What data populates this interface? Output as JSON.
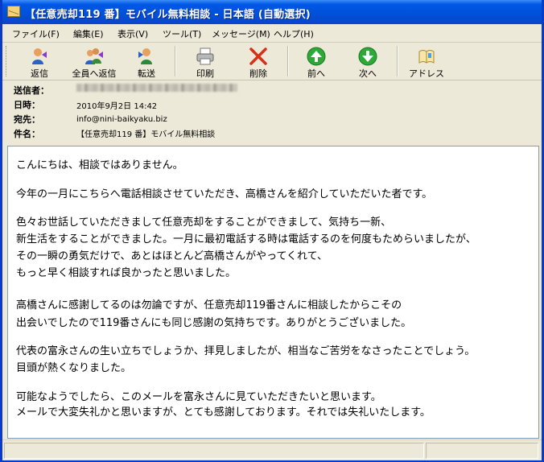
{
  "window": {
    "title": "【任意売却119 番】モバイル無料相談 - 日本語 (自動選択)"
  },
  "menu": [
    {
      "label": "ファイル(F)"
    },
    {
      "label": "編集(E)"
    },
    {
      "label": "表示(V)"
    },
    {
      "label": "ツール(T)"
    },
    {
      "label": "メッセージ(M)"
    },
    {
      "label": "ヘルプ(H)"
    }
  ],
  "toolbar": {
    "reply": "返信",
    "reply_all": "全員へ返信",
    "forward": "転送",
    "print": "印刷",
    "delete": "削除",
    "previous": "前へ",
    "next": "次へ",
    "addresses": "アドレス"
  },
  "header": {
    "from_label": "送信者：",
    "date_label": "日時：",
    "date_value": "2010年9月2日 14:42",
    "to_label": "宛先：",
    "to_value": "info@nini-baikyaku.biz",
    "subject_label": "件名：",
    "subject_value": "【任意売却119 番】モバイル無料相談"
  },
  "message": {
    "p1": "こんにちは、相談ではありません。",
    "p2": "今年の一月にこちらへ電話相談させていただき、高橋さんを紹介していただいた者です。",
    "p3_l1": "色々お世話していただきまして任意売却をすることができまして、気持ち一新、",
    "p3_l2": "新生活をすることができました。一月に最初電話する時は電話するのを何度もためらいましたが、",
    "p3_l3": "その一瞬の勇気だけで、あとはほとんど高橋さんがやってくれて、",
    "p3_l4": "もっと早く相談すれば良かったと思いました。",
    "p4_l1": "高橋さんに感謝してるのは勿論ですが、任意売却119番さんに相談したからこその",
    "p4_l2": "出会いでしたので119番さんにも同じ感謝の気持ちです。ありがとうございました。",
    "p5_l1": "代表の富永さんの生い立ちでしょうか、拝見しましたが、相当なご苦労をなさったことでしょう。",
    "p5_l2": "目頭が熱くなりました。",
    "p6_l1": "可能なようでしたら、このメールを富永さんに見ていただきたいと思います。",
    "p6_l2": "メールで大変失礼かと思いますが、とても感謝しております。それでは失礼いたします。"
  },
  "colors": {
    "titlebar": "#0058e6",
    "chrome": "#ece9d8",
    "delete_icon": "#d83018",
    "nav_icon": "#2ea836"
  }
}
